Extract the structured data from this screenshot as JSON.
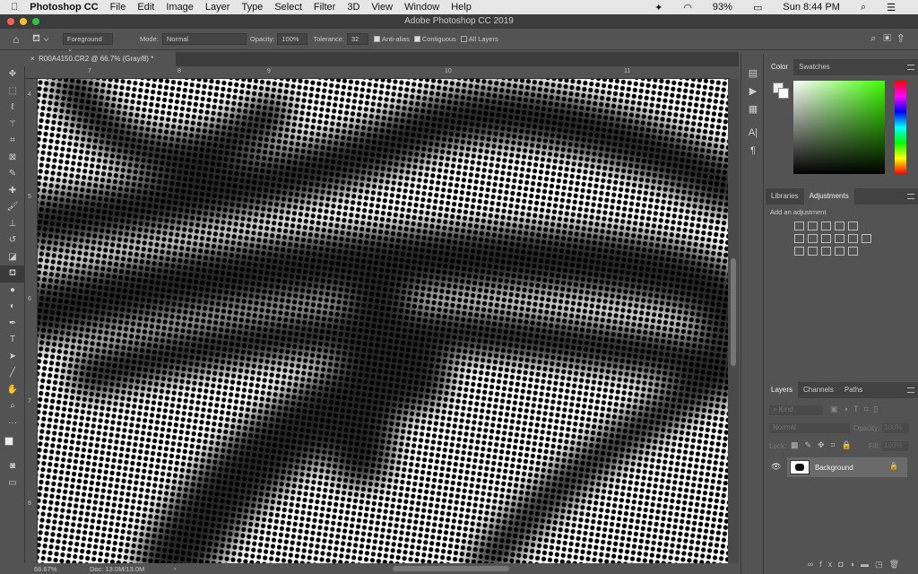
{
  "menubar": {
    "app": "Photoshop CC",
    "items": [
      "File",
      "Edit",
      "Image",
      "Layer",
      "Type",
      "Select",
      "Filter",
      "3D",
      "View",
      "Window",
      "Help"
    ],
    "battery": "93%",
    "clock": "Sun 8:44 PM"
  },
  "window": {
    "title": "Adobe Photoshop CC 2019"
  },
  "options": {
    "fill_source": "Foreground",
    "mode_label": "Mode:",
    "mode": "Normal",
    "opacity_label": "Opacity:",
    "opacity": "100%",
    "tolerance_label": "Tolerance:",
    "tolerance": "32",
    "antialias": {
      "label": "Anti-alias",
      "checked": true
    },
    "contiguous": {
      "label": "Contiguous",
      "checked": true
    },
    "all_layers": {
      "label": "All Layers",
      "checked": false
    }
  },
  "document": {
    "tab": "R00A4150.CR2 @ 66.7% (Gray/8) *",
    "close": "×"
  },
  "rulers": {
    "top": [
      "7",
      "8",
      "9",
      "10",
      "11"
    ],
    "left": [
      "4",
      "5",
      "6",
      "7",
      "8"
    ]
  },
  "status": {
    "zoom": "66.67%",
    "doc": "Doc: 13.0M/13.0M",
    "arrow": "›"
  },
  "tools": [
    "move",
    "marquee",
    "lasso",
    "magic-wand",
    "crop",
    "frame",
    "eyedropper",
    "healing",
    "brush",
    "stamp",
    "history-brush",
    "eraser",
    "paint-bucket",
    "blur",
    "dodge",
    "pen",
    "type",
    "path-select",
    "line",
    "hand",
    "zoom",
    "more"
  ],
  "color_panel": {
    "tabs": [
      "Color",
      "Swatches"
    ],
    "active": "Color",
    "hue_color": "#3dff00"
  },
  "adjustments_panel": {
    "tabs": [
      "Libraries",
      "Adjustments"
    ],
    "active": "Adjustments",
    "hint": "Add an adjustment"
  },
  "layers_panel": {
    "tabs": [
      "Layers",
      "Channels",
      "Paths"
    ],
    "active": "Layers",
    "filter": "Kind",
    "blend": "Normal",
    "opacity_label": "Opacity:",
    "opacity": "100%",
    "lock_label": "Lock:",
    "fill_label": "Fill:",
    "fill": "100%",
    "layers": [
      {
        "name": "Background",
        "visible": true,
        "locked": true
      }
    ],
    "footer_fx": "fx"
  }
}
